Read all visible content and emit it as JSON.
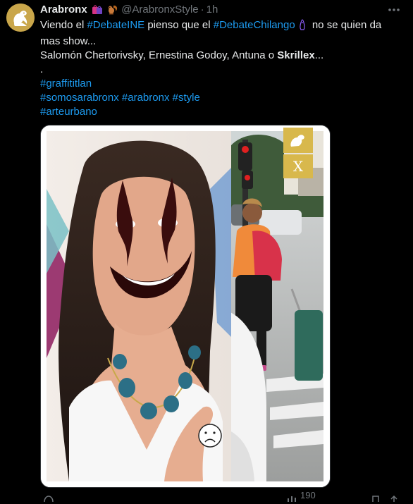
{
  "tweet": {
    "author_name": "Arabronx",
    "author_handle": "@ArabronxStyle",
    "separator": "·",
    "timestamp": "1h",
    "line1_pre": "Viendo el ",
    "line1_tag1": "#DebateINE",
    "line1_mid": " pienso que el ",
    "line1_tag2": "#DebateChilango",
    "line1_post": " no se quien da",
    "line2": "mas show...",
    "line3_pre": "Salomón Chertorivsky, Ernestina Godoy, Antuna o ",
    "line3_bold": "Skrillex",
    "line3_post": "...",
    "line4": ".",
    "hashtag_line1": "#graffititlan",
    "hashtag_line2a": "#somosarabronx",
    "hashtag_line2b": "#arabronx",
    "hashtag_line2c": "#style",
    "hashtag_line3": "#arteurbano"
  },
  "media": {
    "watermark_letter": "X"
  },
  "actions": {
    "views_count": "190"
  },
  "colors": {
    "link": "#1d9bf0",
    "secondary": "#71767b",
    "text": "#e7e9ea",
    "background": "#000000"
  },
  "icons": {
    "avatar": "squirrel-logo",
    "emoji_1": "shopping-bags-emoji",
    "emoji_2": "squirrel-emoji",
    "more": "more-horizontal-icon",
    "reply": "reply-icon",
    "views": "views-icon",
    "bookmark": "bookmark-icon",
    "share": "share-icon"
  }
}
